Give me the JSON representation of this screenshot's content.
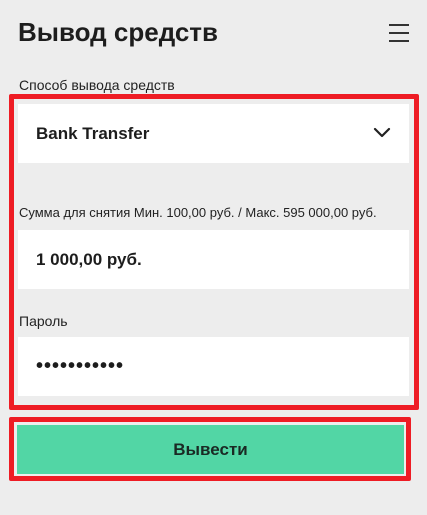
{
  "header": {
    "title": "Вывод средств",
    "menu_icon": "hamburger-menu-icon"
  },
  "form": {
    "method_label": "Способ вывода средств",
    "method_value": "Bank Transfer",
    "method_icon": "chevron-down-icon",
    "amount_label": "Сумма для снятия Мин. 100,00 руб. / Макс. 595 000,00 руб.",
    "amount_value": "1 000,00 руб.",
    "password_label": "Пароль",
    "password_value": "•••••••••••"
  },
  "submit": {
    "label": "Вывести"
  },
  "colors": {
    "accent": "#52d6a5",
    "highlight_border": "#ee1c24",
    "background": "#ededed"
  }
}
